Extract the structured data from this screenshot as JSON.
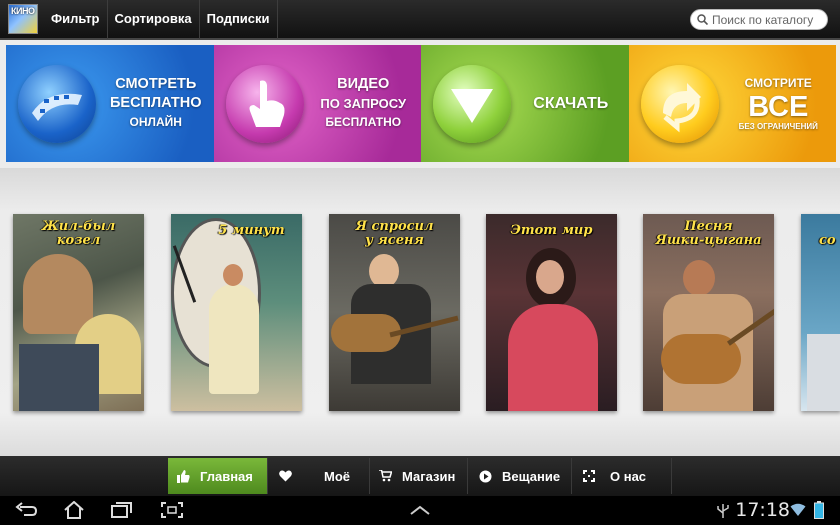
{
  "topbar": {
    "logo_text": "КИНО",
    "menu": [
      "Фильтр",
      "Сортировка",
      "Подписки"
    ],
    "search_placeholder": "Поиск по каталогу"
  },
  "banner": [
    {
      "lines": [
        "СМОТРЕТЬ",
        "БЕСПЛАТНО",
        "ОНЛАЙН"
      ],
      "icon": "film-reel-icon"
    },
    {
      "lines": [
        "ВИДЕО",
        "ПО ЗАПРОСУ",
        "БЕСПЛАТНО"
      ],
      "icon": "pointing-hand-icon"
    },
    {
      "lines": [
        "СКАЧАТЬ"
      ],
      "icon": "download-arrow-icon"
    },
    {
      "lines": [
        "СМОТРИТЕ",
        "ВСЕ",
        "БЕЗ ОГРАНИЧЕНИЙ"
      ],
      "icon": "refresh-arrows-icon"
    }
  ],
  "posters": [
    {
      "title": "Жил-был\nкозел"
    },
    {
      "title": "5 минут"
    },
    {
      "title": "Я спросил\nу ясеня"
    },
    {
      "title": "Этот мир"
    },
    {
      "title": "Песня\nЯшки-цыгана"
    },
    {
      "title": "со"
    }
  ],
  "tabs": [
    {
      "label": "Главная",
      "icon": "thumbs-up-icon",
      "active": true
    },
    {
      "label": "Моё",
      "icon": "heart-icon",
      "active": false
    },
    {
      "label": "Магазин",
      "icon": "cart-icon",
      "active": false
    },
    {
      "label": "Вещание",
      "icon": "play-icon",
      "active": false
    },
    {
      "label": "О нас",
      "icon": "info-icon",
      "active": false
    }
  ],
  "system": {
    "time": "17:18"
  },
  "colors": {
    "banner_blue": "#1a5fc2",
    "banner_pink": "#a72a99",
    "banner_green": "#5c9f23",
    "banner_yellow": "#ec9a0b",
    "active_tab": "#6aab30",
    "poster_title": "#ffe24a"
  }
}
